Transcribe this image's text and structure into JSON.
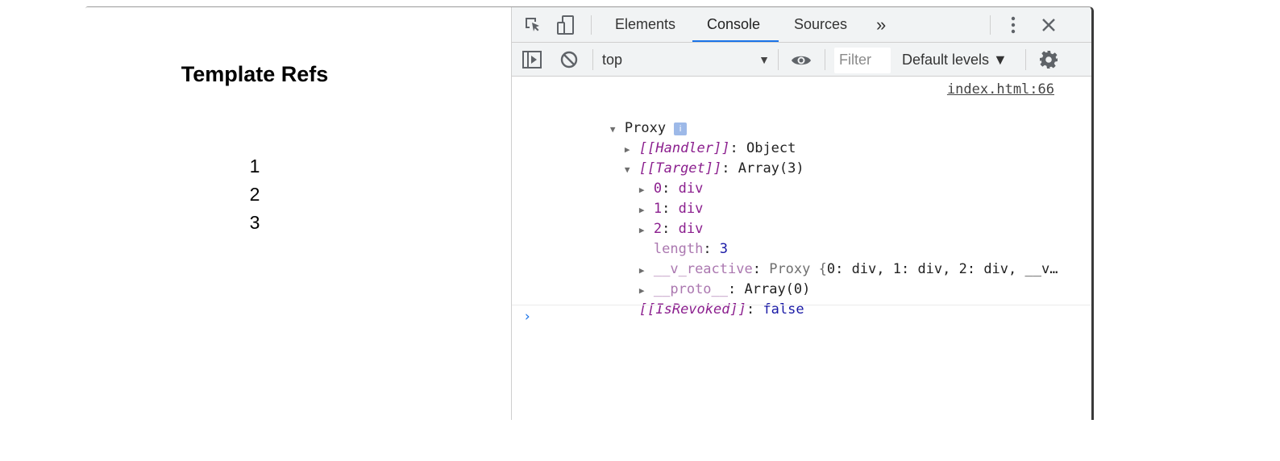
{
  "page": {
    "title": "Template Refs",
    "items": [
      "1",
      "2",
      "3"
    ]
  },
  "devtools": {
    "tabs": [
      "Elements",
      "Console",
      "Sources"
    ],
    "active_tab": "Console",
    "more_tabs": "»",
    "context": "top",
    "filter_placeholder": "Filter",
    "levels": "Default levels ▼",
    "accent_color": "#1a73e8"
  },
  "console": {
    "source": "index.html:66",
    "root_label": "Proxy",
    "info_badge": "i",
    "handler_key": "[[Handler]]",
    "handler_value": "Object",
    "target_key": "[[Target]]",
    "target_value": "Array(3)",
    "elements": [
      {
        "index": "0",
        "value": "div"
      },
      {
        "index": "1",
        "value": "div"
      },
      {
        "index": "2",
        "value": "div"
      }
    ],
    "length_key": "length",
    "length_value": "3",
    "reactive_key": "__v_reactive",
    "reactive_value_prefix": "Proxy {",
    "reactive_value_preview": "0: div, 1: div, 2: div, __v…",
    "proto_key": "__proto__",
    "proto_value": "Array(0)",
    "revoked_key": "[[IsRevoked]]",
    "revoked_value": "false",
    "prompt": "›"
  }
}
